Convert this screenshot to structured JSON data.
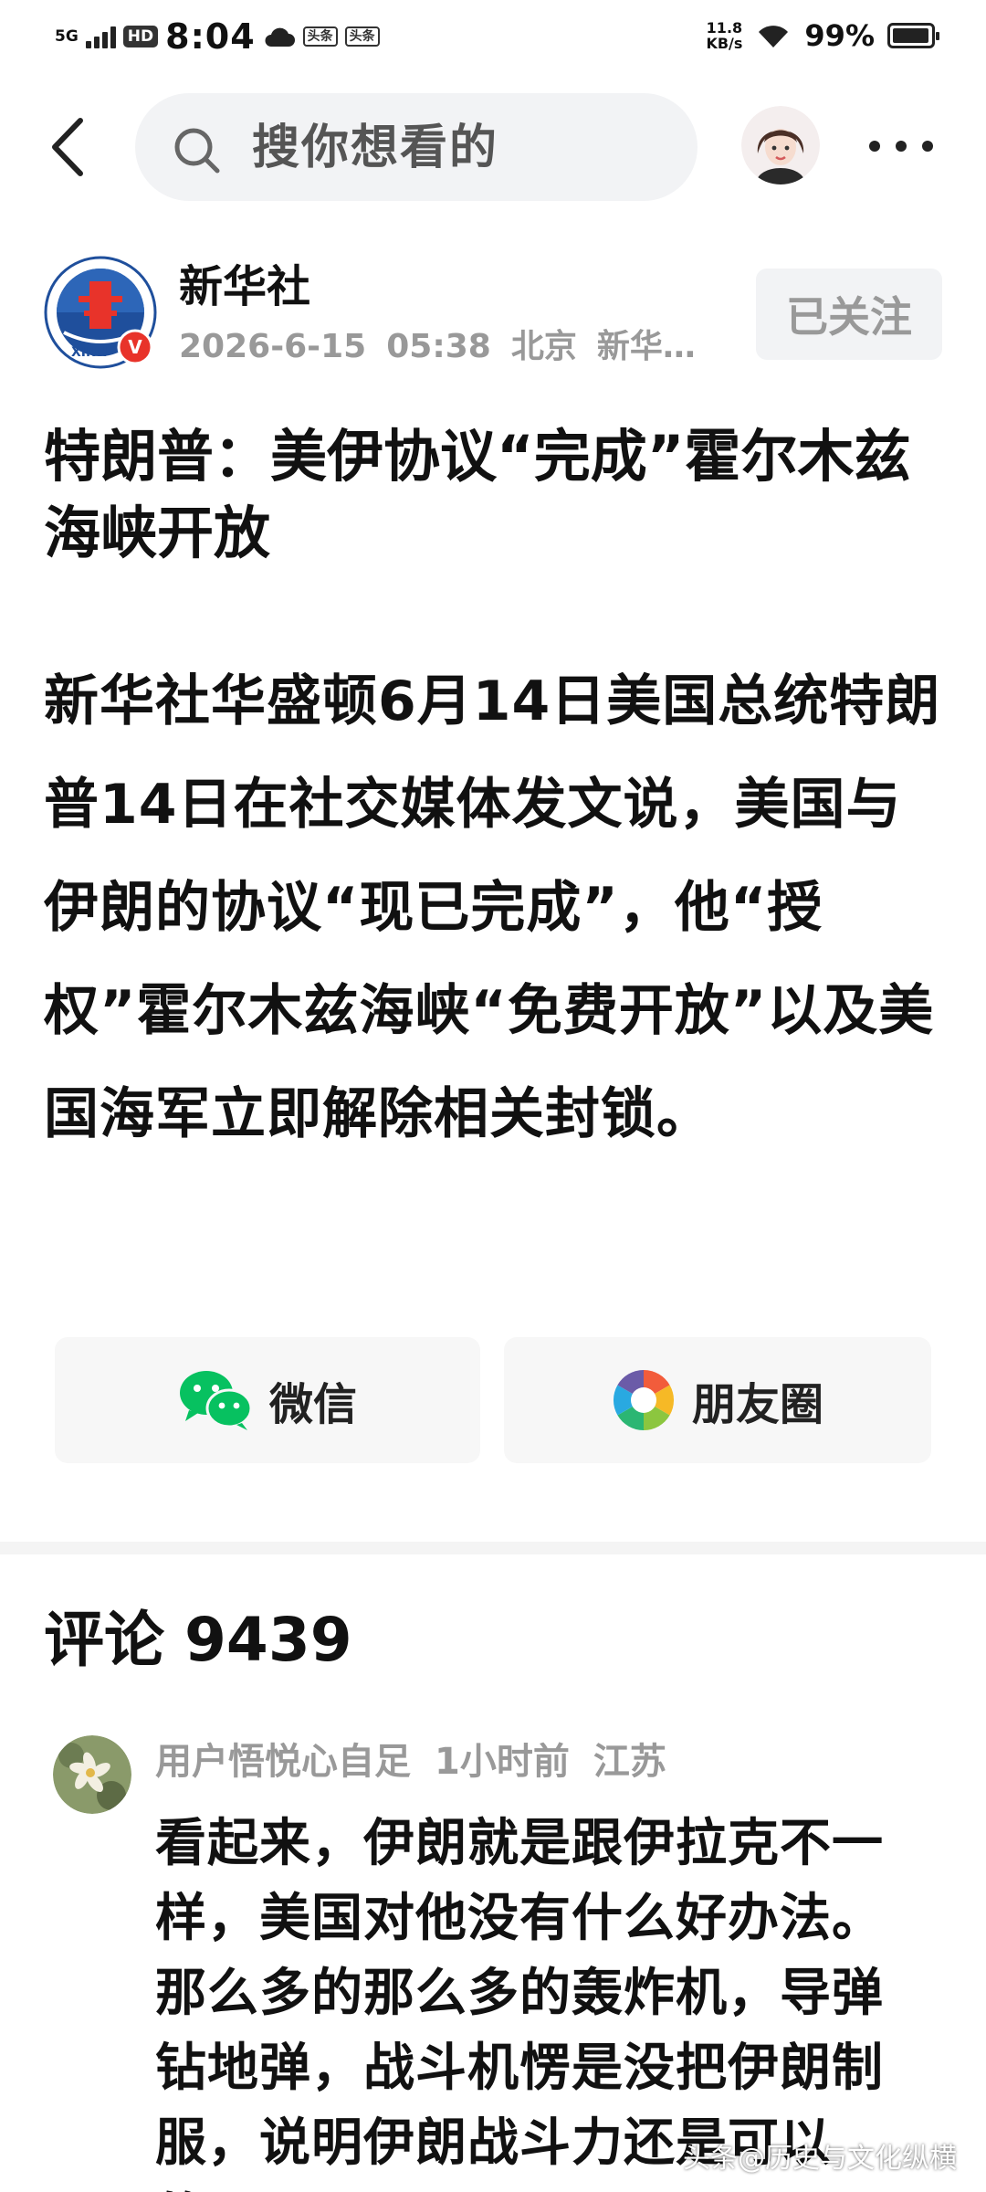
{
  "status_bar": {
    "network": "5G",
    "hd_badge": "HD",
    "time": "8:04",
    "app_badges": [
      "头条",
      "头条"
    ],
    "net_speed_value": "11.8",
    "net_speed_unit": "KB/s",
    "battery_percent": "99%",
    "battery_level": 0.99
  },
  "top_bar": {
    "search_placeholder": "搜你想看的"
  },
  "source": {
    "name": "新华社",
    "date": "2026-6-15",
    "time": "05:38",
    "location": "北京",
    "extra": "新华…",
    "follow_label": "已关注",
    "verified_badge": "V"
  },
  "article": {
    "title": "特朗普：美伊协议“完成”霍尔木兹海峡开放",
    "body": "新华社华盛顿6月14日美国总统特朗普14日在社交媒体发文说，美国与伊朗的协议“现已完成”，他“授权”霍尔木兹海峡“免费开放”以及美国海军立即解除相关封锁。"
  },
  "share": {
    "wechat_label": "微信",
    "moments_label": "朋友圈"
  },
  "comments": {
    "label": "评论",
    "count": "9439",
    "items": [
      {
        "user": "用户悟悦心自足",
        "time": "1小时前",
        "location": "江苏",
        "text": "看起来，伊朗就是跟伊拉克不一样，美国对他没有什么好办法。那么多的那么多的轰炸机，导弹钻地弹，战斗机愣是没把伊朗制服，说明伊朗战斗力还是可以的！"
      }
    ]
  },
  "watermark": "头条@历史与文化纵横",
  "colors": {
    "text_primary": "#111111",
    "text_secondary": "#999999",
    "search_bg": "#f2f3f5",
    "wechat_green": "#07c160",
    "verified_red": "#e8332a",
    "logo_blue": "#1f4f9c"
  }
}
